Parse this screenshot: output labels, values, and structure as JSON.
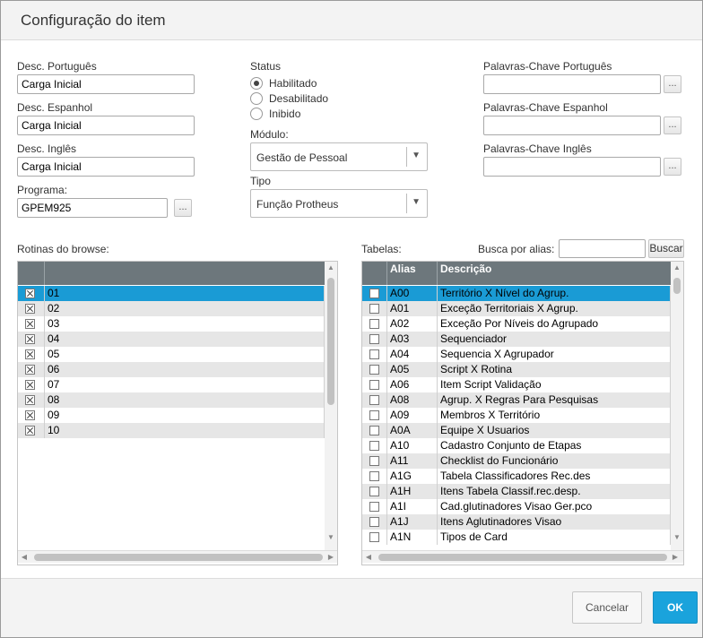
{
  "dialog": {
    "title": "Configuração do item"
  },
  "form": {
    "desc_pt_label": "Desc. Português",
    "desc_pt_value": "Carga Inicial",
    "desc_es_label": "Desc. Espanhol",
    "desc_es_value": "Carga Inicial",
    "desc_en_label": "Desc. Inglês",
    "desc_en_value": "Carga Inicial",
    "programa_label": "Programa:",
    "programa_value": "GPEM925",
    "ellipsis": "...",
    "status_label": "Status",
    "status_options": [
      "Habilitado",
      "Desabilitado",
      "Inibido"
    ],
    "status_selected": "Habilitado",
    "modulo_label": "Módulo:",
    "modulo_value": "Gestão de Pessoal",
    "tipo_label": "Tipo",
    "tipo_value": "Função Protheus",
    "kw_pt_label": "Palavras-Chave Português",
    "kw_pt_value": "",
    "kw_es_label": "Palavras-Chave Espanhol",
    "kw_es_value": "",
    "kw_en_label": "Palavras-Chave Inglês",
    "kw_en_value": ""
  },
  "browse": {
    "label": "Rotinas do browse:",
    "rows": [
      {
        "value": "01",
        "checked": true
      },
      {
        "value": "02",
        "checked": true
      },
      {
        "value": "03",
        "checked": true
      },
      {
        "value": "04",
        "checked": true
      },
      {
        "value": "05",
        "checked": true
      },
      {
        "value": "06",
        "checked": true
      },
      {
        "value": "07",
        "checked": true
      },
      {
        "value": "08",
        "checked": true
      },
      {
        "value": "09",
        "checked": true
      },
      {
        "value": "10",
        "checked": true
      }
    ],
    "selected_index": 0
  },
  "tables": {
    "label": "Tabelas:",
    "search_label": "Busca por alias:",
    "search_value": "",
    "search_button": "Buscar",
    "columns": [
      "Alias",
      "Descrição"
    ],
    "rows": [
      {
        "alias": "A00",
        "desc": "Território X Nível do Agrup.",
        "checked": false
      },
      {
        "alias": "A01",
        "desc": "Exceção Territoriais X Agrup.",
        "checked": false
      },
      {
        "alias": "A02",
        "desc": "Exceção Por Níveis do Agrupado",
        "checked": false
      },
      {
        "alias": "A03",
        "desc": "Sequenciador",
        "checked": false
      },
      {
        "alias": "A04",
        "desc": "Sequencia X Agrupador",
        "checked": false
      },
      {
        "alias": "A05",
        "desc": "Script X Rotina",
        "checked": false
      },
      {
        "alias": "A06",
        "desc": "Item Script Validação",
        "checked": false
      },
      {
        "alias": "A08",
        "desc": "Agrup. X Regras Para Pesquisas",
        "checked": false
      },
      {
        "alias": "A09",
        "desc": "Membros X Território",
        "checked": false
      },
      {
        "alias": "A0A",
        "desc": "Equipe X Usuarios",
        "checked": false
      },
      {
        "alias": "A10",
        "desc": "Cadastro Conjunto de Etapas",
        "checked": false
      },
      {
        "alias": "A11",
        "desc": "Checklist do Funcionário",
        "checked": false
      },
      {
        "alias": "A1G",
        "desc": "Tabela Classificadores Rec.des",
        "checked": false
      },
      {
        "alias": "A1H",
        "desc": "Itens Tabela Classif.rec.desp.",
        "checked": false
      },
      {
        "alias": "A1I",
        "desc": "Cad.glutinadores Visao Ger.pco",
        "checked": false
      },
      {
        "alias": "A1J",
        "desc": "Itens Aglutinadores Visao",
        "checked": false
      },
      {
        "alias": "A1N",
        "desc": "Tipos de Card",
        "checked": false
      }
    ],
    "selected_index": 0
  },
  "footer": {
    "cancel_label": "Cancelar",
    "ok_label": "OK"
  },
  "colors": {
    "accent": "#1a9bd5",
    "header": "#6d777c",
    "alt_row": "#e6e6e6",
    "ok_button": "#1aa3dc"
  }
}
